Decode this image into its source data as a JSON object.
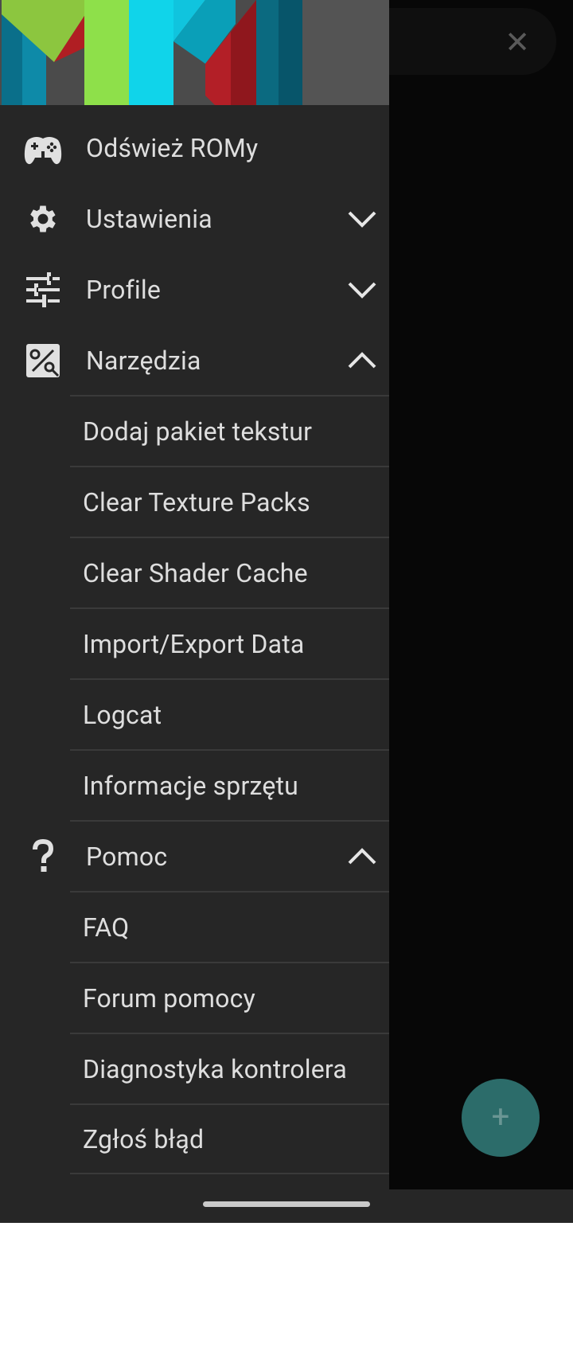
{
  "drawer": {
    "main_items": [
      {
        "label": "Odśwież ROMy",
        "icon": "gamepad-icon"
      },
      {
        "label": "Ustawienia",
        "icon": "gear-icon",
        "expanded": false
      },
      {
        "label": "Profile",
        "icon": "sliders-icon",
        "expanded": false
      },
      {
        "label": "Narzędzia",
        "icon": "tools-icon",
        "expanded": true
      },
      {
        "label": "Pomoc",
        "icon": "question-icon",
        "expanded": true
      }
    ],
    "tools_items": [
      "Dodaj pakiet tekstur",
      "Clear Texture Packs",
      "Clear Shader Cache",
      "Import/Export Data",
      "Logcat",
      "Informacje sprzętu"
    ],
    "help_items": [
      "FAQ",
      "Forum pomocy",
      "Diagnostyka kontrolera",
      "Zgłoś błąd"
    ]
  },
  "background": {
    "close_glyph": "✕",
    "fab_glyph": "+"
  },
  "colors": {
    "drawer_bg": "#262626",
    "text": "#dedede",
    "fab": "#2c6c6a",
    "divider": "#3a3a3a"
  }
}
